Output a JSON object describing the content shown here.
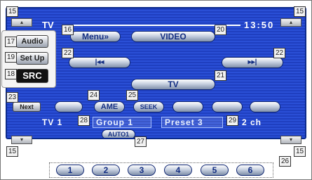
{
  "screen": {
    "source": "TV",
    "clock": "13:50",
    "menu_label": "Menu»",
    "mode_label": "VIDEO",
    "prev_label": "|◂◂",
    "next_label": "▸▸|",
    "tv_label": "TV",
    "ame_label": "AME",
    "seek_label": "SEEK",
    "status": {
      "tuner": "TV 1",
      "group": "Group 1",
      "preset": "Preset 3",
      "channel": "2 ch"
    }
  },
  "side_menu": {
    "audio": "Audio",
    "setup": "Set Up",
    "src": "SRC",
    "next": "Next"
  },
  "auto_label": "AUTO1",
  "presets": [
    "1",
    "2",
    "3",
    "4",
    "5",
    "6"
  ],
  "callouts": {
    "b15": "15",
    "b16": "16",
    "b17": "17",
    "b18": "18",
    "b19": "19",
    "b20": "20",
    "b21": "21",
    "b22": "22",
    "b23": "23",
    "b24": "24",
    "b25": "25",
    "b26": "26",
    "b27": "27",
    "b28": "28",
    "b29": "29"
  }
}
